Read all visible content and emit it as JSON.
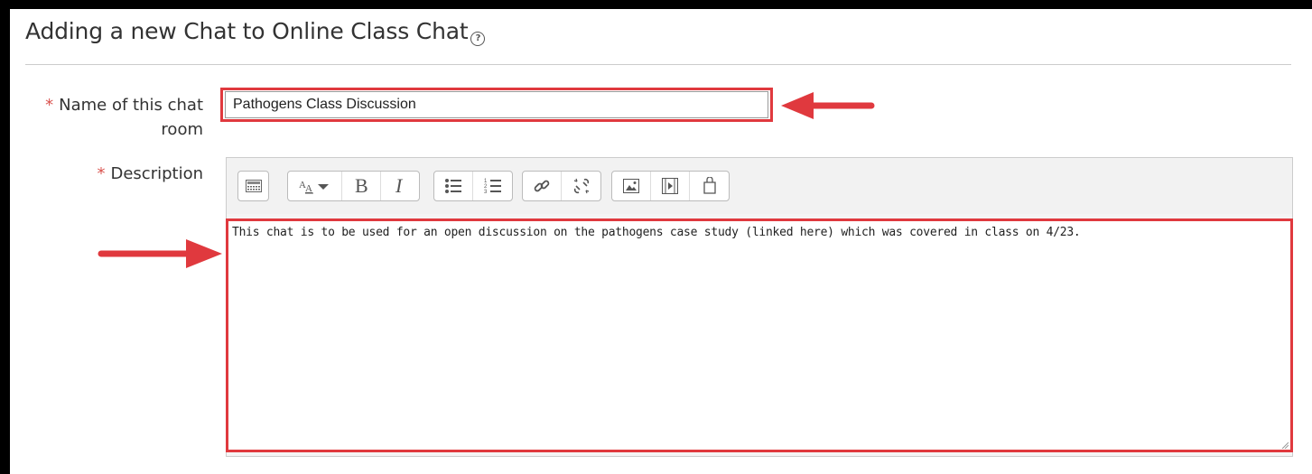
{
  "page": {
    "title": "Adding a new Chat to Online Class Chat",
    "help_icon": "question-circle-icon"
  },
  "form": {
    "name_field": {
      "required_marker": "*",
      "label_line1": "Name of this chat",
      "label_line2": "room",
      "value": "Pathogens Class Discussion"
    },
    "description_field": {
      "required_marker": "*",
      "label": "Description",
      "value": "This chat is to be used for an open discussion on the pathogens case study (linked here) which was covered in class on 4/23."
    }
  },
  "toolbar": {
    "groups": [
      [
        "show-more-buttons-icon"
      ],
      [
        "font-style-dropdown-icon",
        "bold-icon",
        "italic-icon"
      ],
      [
        "bullet-list-icon",
        "numbered-list-icon"
      ],
      [
        "link-icon",
        "unlink-icon"
      ],
      [
        "image-icon",
        "media-icon",
        "manage-files-icon"
      ]
    ]
  },
  "annotations": {
    "arrow_color": "#e0393e",
    "highlight_color": "#e0393e"
  }
}
